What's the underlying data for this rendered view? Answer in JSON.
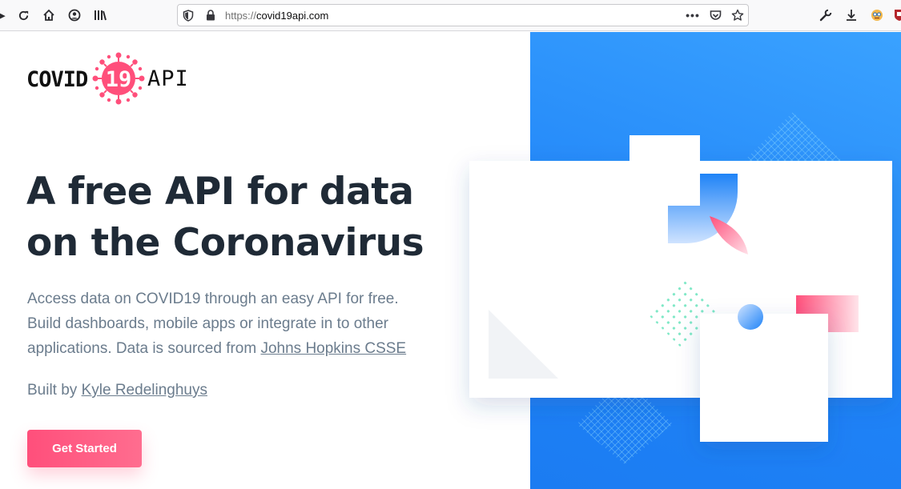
{
  "browser": {
    "url_scheme": "https://",
    "url_host": "covid19api.com",
    "icons": {
      "left": [
        "forward-icon",
        "reload-icon",
        "home-icon",
        "account-icon",
        "library-icon"
      ],
      "url": [
        "shield-icon",
        "lock-icon",
        "more-icon",
        "pocket-icon",
        "bookmark-star-icon"
      ],
      "right": [
        "wrench-icon",
        "download-icon",
        "extension-avatar-icon",
        "extension-shield-icon"
      ]
    }
  },
  "logo": {
    "covid": "COVID",
    "number": "19",
    "api": "API",
    "accent_color": "#ff4f7b"
  },
  "hero": {
    "headline_line1": "A free API for data",
    "headline_line2": "on the Coronavirus",
    "lead_text": "Access data on COVID19 through an easy API for free. Build dashboards, mobile apps or integrate in to other applications. Data is sourced from ",
    "lead_link": "Johns Hopkins CSSE",
    "byline_prefix": "Built by ",
    "byline_link": "Kyle Redelinghuys",
    "cta_label": "Get Started"
  },
  "colors": {
    "panel_blue": "#1f83f7",
    "heading": "#1f2a36",
    "body_text": "#6b7c8d",
    "pink": "#ff4f7b",
    "mint": "#7ee8c6"
  }
}
